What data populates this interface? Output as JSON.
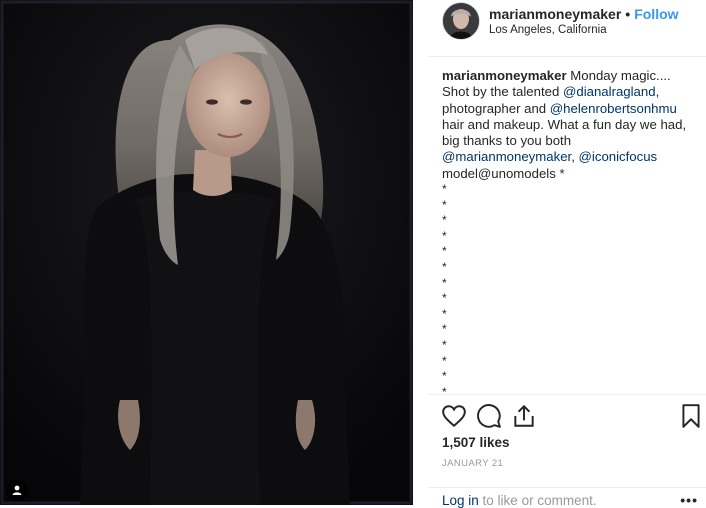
{
  "post": {
    "photo": {
      "alt": "Portrait of a woman with long gray hair wearing black"
    },
    "header": {
      "username": "marianmoneymaker",
      "separator": "•",
      "follow_label": "Follow",
      "location": "Los Angeles, California"
    },
    "caption": {
      "author": "marianmoneymaker",
      "text_1": " Monday magic.... Shot by the talented ",
      "mention_1": "@dianalragland",
      "text_2": ", photographer and ",
      "mention_2": "@helenrobertsonhmu",
      "text_3": " hair and makeup. What a fun day we had, big thanks to you both ",
      "mention_3": "@marianmoneymaker",
      "text_4": ", ",
      "mention_4": "@iconicfocus",
      "text_5": " model@unomodels *",
      "stars": [
        "*",
        "*",
        "*",
        "*",
        "*",
        "*",
        "*",
        "*",
        "*",
        "*",
        "*",
        "*",
        "*",
        "*"
      ]
    },
    "actions": {
      "like_icon": "heart-icon",
      "comment_icon": "comment-icon",
      "share_icon": "share-icon",
      "save_icon": "bookmark-icon"
    },
    "likes": "1,507 likes",
    "date": "JANUARY 21",
    "login": {
      "link": "Log in",
      "text": " to like or comment.",
      "more": "•••"
    }
  },
  "colors": {
    "link": "#003569",
    "follow": "#3897f0",
    "muted": "#999999"
  }
}
